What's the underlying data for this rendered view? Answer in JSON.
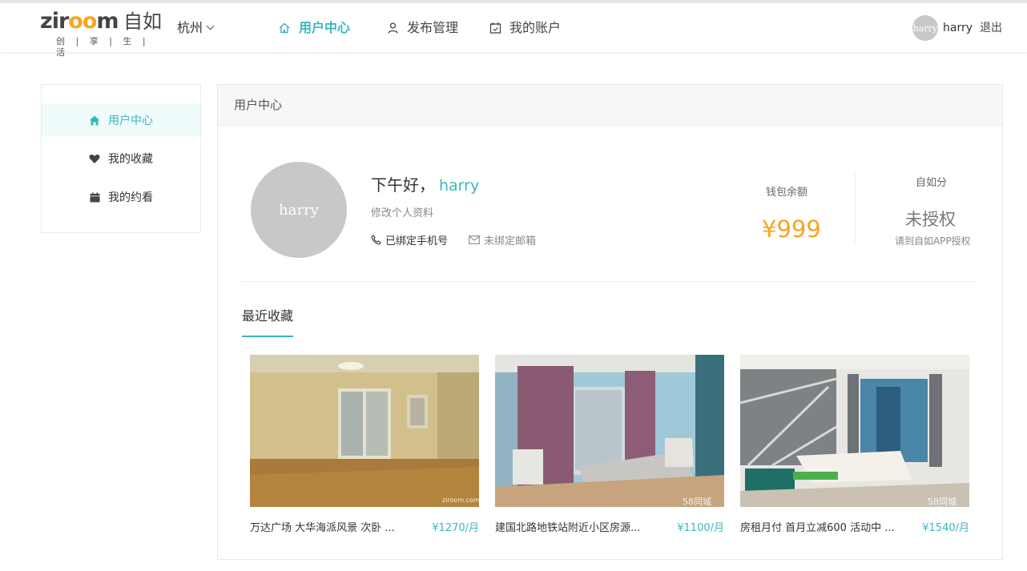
{
  "header": {
    "logo": {
      "main_a": "zir",
      "main_oo": "oo",
      "main_b": "m",
      "cn": "自如",
      "slogan": "创 | 享 | 生 | 活"
    },
    "city": "杭州",
    "nav": [
      {
        "label": "用户中心",
        "icon": "home-icon",
        "active": true
      },
      {
        "label": "发布管理",
        "icon": "user-icon",
        "active": false
      },
      {
        "label": "我的账户",
        "icon": "calendar-icon",
        "active": false
      }
    ],
    "user": {
      "avatar_text": "harry",
      "name": "harry"
    },
    "logout": "退出"
  },
  "sidebar": {
    "items": [
      {
        "label": "用户中心",
        "icon": "home-icon",
        "active": true
      },
      {
        "label": "我的收藏",
        "icon": "heart-icon",
        "active": false
      },
      {
        "label": "我的约看",
        "icon": "calendar-icon",
        "active": false
      }
    ]
  },
  "main": {
    "title": "用户中心",
    "profile": {
      "avatar_text": "harry",
      "greeting": "下午好，",
      "name": "harry",
      "edit_link": "修改个人资料",
      "phone_status": "已绑定手机号",
      "email_status": "未绑定邮箱"
    },
    "wallet": {
      "label": "钱包余额",
      "value": "¥999"
    },
    "score": {
      "label": "自如分",
      "value": "未授权",
      "hint": "请到自如APP授权"
    },
    "favorites": {
      "title": "最近收藏",
      "items": [
        {
          "title": "万达广场 大华海派风景 次卧 ...",
          "price": "¥1270/月",
          "watermark": "ziroom.com"
        },
        {
          "title": "建国北路地铁站附近小区房源...",
          "price": "¥1100/月",
          "watermark": "58同城"
        },
        {
          "title": "房租月付 首月立减600 活动中 ...",
          "price": "¥1540/月",
          "watermark": "58同城"
        }
      ]
    }
  },
  "colors": {
    "accent": "#3ab7bf",
    "price": "#f5a623",
    "avatar": "#c8c8c8"
  }
}
